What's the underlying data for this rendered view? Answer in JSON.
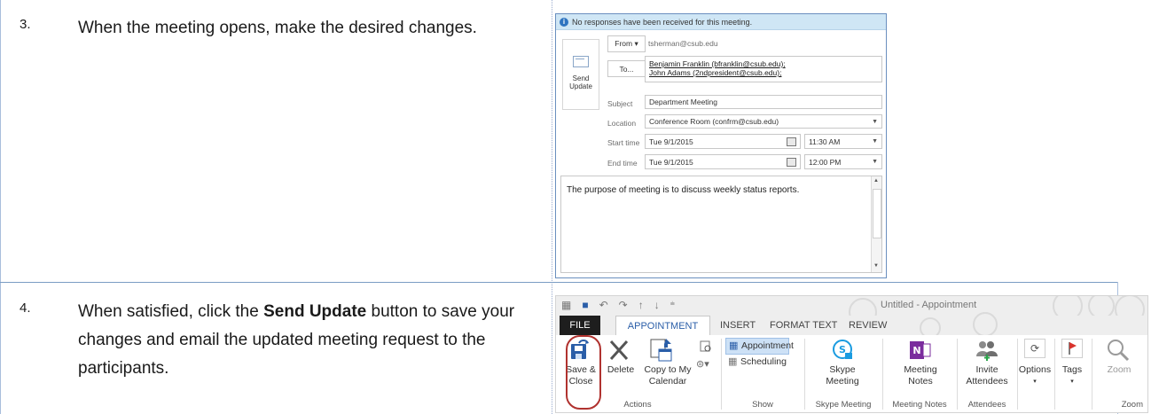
{
  "steps": [
    {
      "number": "3.",
      "text": "When the meeting opens, make the desired changes."
    },
    {
      "number": "4.",
      "text_before": "When satisfied, click the ",
      "text_bold": "Send Update",
      "text_after": " button to save your changes and email the updated meeting request to the participants."
    }
  ],
  "meeting_form": {
    "info_message": "No responses have been received for this meeting.",
    "send_label_line1": "Send",
    "send_label_line2": "Update",
    "from_button": "From ▾",
    "from_value": "tsherman@csub.edu",
    "to_button": "To...",
    "recipients": [
      "Benjamin Franklin (bfranklin@csub.edu);",
      "John Adams (2ndpresident@csub.edu);"
    ],
    "subject_label": "Subject",
    "subject_value": "Department Meeting",
    "location_label": "Location",
    "location_value": "Conference Room (confrm@csub.edu)",
    "start_label": "Start time",
    "start_date": "Tue 9/1/2015",
    "start_time": "11:30 AM",
    "end_label": "End time",
    "end_date": "Tue 9/1/2015",
    "end_time": "12:00 PM",
    "body_text": "The purpose of meeting is to discuss weekly status reports."
  },
  "ribbon": {
    "window_title": "Untitled - Appointment",
    "tabs": [
      "FILE",
      "APPOINTMENT",
      "INSERT",
      "FORMAT TEXT",
      "REVIEW"
    ],
    "buttons": {
      "save_close_1": "Save &",
      "save_close_2": "Close",
      "delete": "Delete",
      "copy_1": "Copy to My",
      "copy_2": "Calendar",
      "appointment": "Appointment",
      "scheduling": "Scheduling",
      "skype_1": "Skype",
      "skype_2": "Meeting",
      "notes_1": "Meeting",
      "notes_2": "Notes",
      "invite_1": "Invite",
      "invite_2": "Attendees",
      "options": "Options",
      "tags": "Tags",
      "zoom": "Zoom"
    },
    "groups": [
      "Actions",
      "Show",
      "Skype Meeting",
      "Meeting Notes",
      "Attendees",
      "Zoom"
    ],
    "colors": {
      "highlight": "#b0322f",
      "accent": "#2a5ea8"
    }
  }
}
